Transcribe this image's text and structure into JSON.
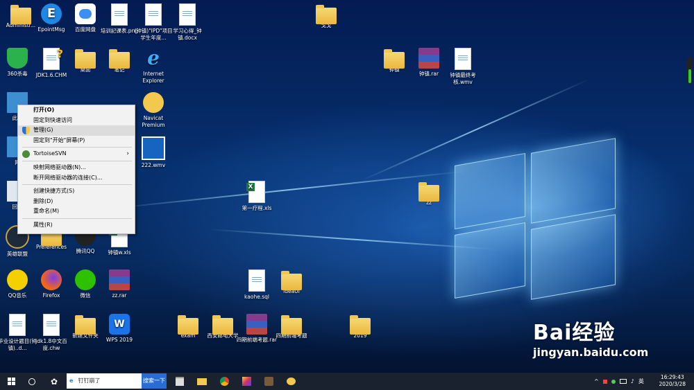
{
  "desktop_icons": [
    {
      "label": "Administr...",
      "icon": "user-folder"
    },
    {
      "label": "EpointMsg",
      "icon": "app-e"
    },
    {
      "label": "百度网盘",
      "icon": "cloud"
    },
    {
      "label": "培训記课表.png",
      "icon": "image"
    },
    {
      "label": "(钟镇)\"IPD\"项目学生年度...",
      "icon": "doc"
    },
    {
      "label": "学习心得_钟镇.docx",
      "icon": "doc"
    },
    {
      "label": "戈戈",
      "icon": "folder"
    },
    {
      "label": "360杀毒",
      "icon": "shield"
    },
    {
      "label": "JDK1.6.CHM",
      "icon": "help-file"
    },
    {
      "label": "桌面",
      "icon": "folder"
    },
    {
      "label": "笔记",
      "icon": "folder"
    },
    {
      "label": "Internet Explorer",
      "icon": "ie"
    },
    {
      "label": "钟镇",
      "icon": "folder"
    },
    {
      "label": "钟镇.rar",
      "icon": "rar"
    },
    {
      "label": "钟镇最终考核.wmv",
      "icon": "video"
    },
    {
      "label": "此电",
      "icon": "computer"
    },
    {
      "label": "Navicat Premium",
      "icon": "navicat"
    },
    {
      "label": "网",
      "icon": "network"
    },
    {
      "label": "222.wmv",
      "icon": "video"
    },
    {
      "label": "回收",
      "icon": "recycle"
    },
    {
      "label": "第一疗程.xls",
      "icon": "xls"
    },
    {
      "label": "zz",
      "icon": "folder"
    },
    {
      "label": "英雄联盟",
      "icon": "lol"
    },
    {
      "label": "Preferences",
      "icon": "folder"
    },
    {
      "label": "腾讯QQ",
      "icon": "qq"
    },
    {
      "label": "钟镇w.xls",
      "icon": "xls"
    },
    {
      "label": "QQ音乐",
      "icon": "qqmusic"
    },
    {
      "label": "Firefox",
      "icon": "firefox"
    },
    {
      "label": "微信",
      "icon": "wechat"
    },
    {
      "label": "zz.rar",
      "icon": "rar"
    },
    {
      "label": "kaohe.sql",
      "icon": "doc"
    },
    {
      "label": "ideaUI",
      "icon": "folder"
    },
    {
      "label": "毕业设计题目(钟镇)..d...",
      "icon": "doc"
    },
    {
      "label": "jdk1.8中文百度.chw",
      "icon": "doc"
    },
    {
      "label": "新建文件夹",
      "icon": "folder"
    },
    {
      "label": "WPS 2019",
      "icon": "wps"
    },
    {
      "label": "exam",
      "icon": "folder"
    },
    {
      "label": "西安邮电大学",
      "icon": "folder"
    },
    {
      "label": "四期前端考题.rar",
      "icon": "rar"
    },
    {
      "label": "四期前端考题",
      "icon": "folder"
    },
    {
      "label": "2019",
      "icon": "folder"
    }
  ],
  "context_menu": [
    {
      "label": "打开(O)",
      "bold": true
    },
    {
      "label": "固定到快速访问"
    },
    {
      "label": "管理(G)",
      "icon": "shield-uac"
    },
    {
      "label": "固定到\"开始\"屏幕(P)"
    },
    {
      "separator": true
    },
    {
      "label": "TortoiseSVN",
      "icon": "tortoise",
      "submenu": true
    },
    {
      "separator": true
    },
    {
      "label": "映射网络驱动器(N)..."
    },
    {
      "label": "断开网络驱动器的连接(C)..."
    },
    {
      "separator": true
    },
    {
      "label": "创建快捷方式(S)"
    },
    {
      "label": "删除(D)"
    },
    {
      "label": "重命名(M)"
    },
    {
      "separator": true
    },
    {
      "label": "属性(R)"
    }
  ],
  "taskbar": {
    "search_text": "钉钉崩了",
    "search_button": "搜索一下",
    "ime": "英",
    "time": "16:29:43",
    "date": "2020/3/28"
  },
  "watermark": {
    "brand": "Bai经验",
    "url": "jingyan.baidu.com"
  },
  "colors": {
    "accent": "#2a6cd6",
    "menu_bg": "#f2f2f2",
    "taskbar": "#1a2230"
  }
}
